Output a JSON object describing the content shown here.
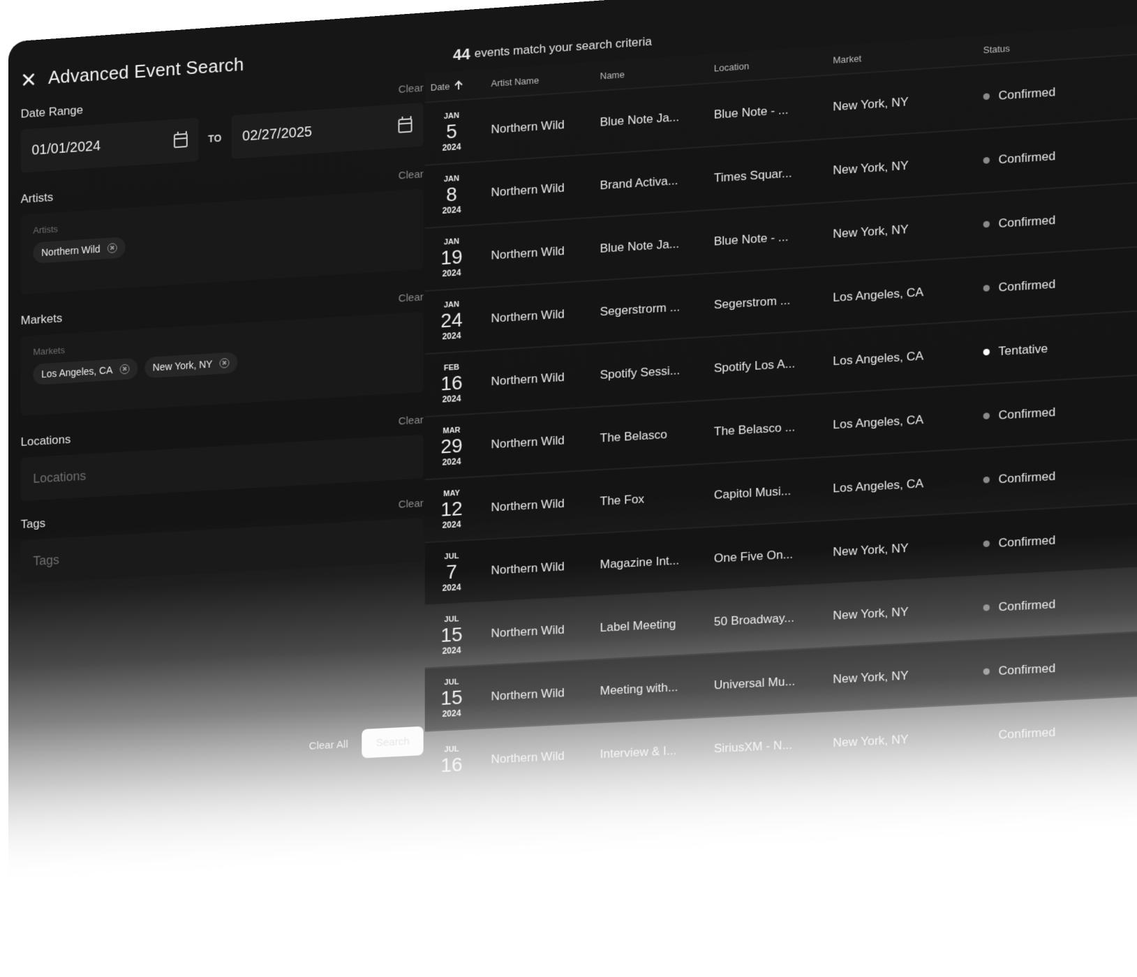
{
  "search": {
    "title": "Advanced Event Search",
    "date_range": {
      "label": "Date Range",
      "clear": "Clear",
      "from": "01/01/2024",
      "to_label": "TO",
      "to": "02/27/2025"
    },
    "artists": {
      "label": "Artists",
      "clear": "Clear",
      "field_label": "Artists",
      "chips": [
        "Northern Wild"
      ]
    },
    "markets": {
      "label": "Markets",
      "clear": "Clear",
      "field_label": "Markets",
      "chips": [
        "Los Angeles, CA",
        "New York, NY"
      ]
    },
    "locations": {
      "label": "Locations",
      "clear": "Clear",
      "placeholder": "Locations"
    },
    "tags": {
      "label": "Tags",
      "clear": "Clear",
      "placeholder": "Tags"
    },
    "footer": {
      "clear_all": "Clear All",
      "search": "Search"
    }
  },
  "results": {
    "count": "44",
    "count_text": "events match your search criteria",
    "columns": {
      "date": "Date",
      "artist": "Artist Name",
      "name": "Name",
      "location": "Location",
      "market": "Market",
      "status": "Status"
    },
    "rows": [
      {
        "month": "JAN",
        "day": "5",
        "year": "2024",
        "artist": "Northern Wild",
        "name": "Blue Note Ja...",
        "location": "Blue Note - ...",
        "market": "New York, NY",
        "status": "Confirmed"
      },
      {
        "month": "JAN",
        "day": "8",
        "year": "2024",
        "artist": "Northern Wild",
        "name": "Brand Activa...",
        "location": "Times Squar...",
        "market": "New York, NY",
        "status": "Confirmed"
      },
      {
        "month": "JAN",
        "day": "19",
        "year": "2024",
        "artist": "Northern Wild",
        "name": "Blue Note Ja...",
        "location": "Blue Note - ...",
        "market": "New York, NY",
        "status": "Confirmed"
      },
      {
        "month": "JAN",
        "day": "24",
        "year": "2024",
        "artist": "Northern Wild",
        "name": "Segerstrorm ...",
        "location": "Segerstrom ...",
        "market": "Los Angeles, CA",
        "status": "Confirmed"
      },
      {
        "month": "FEB",
        "day": "16",
        "year": "2024",
        "artist": "Northern Wild",
        "name": "Spotify Sessi...",
        "location": "Spotify Los A...",
        "market": "Los Angeles, CA",
        "status": "Tentative"
      },
      {
        "month": "MAR",
        "day": "29",
        "year": "2024",
        "artist": "Northern Wild",
        "name": "The Belasco",
        "location": "The Belasco ...",
        "market": "Los Angeles, CA",
        "status": "Confirmed"
      },
      {
        "month": "MAY",
        "day": "12",
        "year": "2024",
        "artist": "Northern Wild",
        "name": "The Fox",
        "location": "Capitol Musi...",
        "market": "Los Angeles, CA",
        "status": "Confirmed"
      },
      {
        "month": "JUL",
        "day": "7",
        "year": "2024",
        "artist": "Northern Wild",
        "name": "Magazine Int...",
        "location": "One Five On...",
        "market": "New York, NY",
        "status": "Confirmed"
      },
      {
        "month": "JUL",
        "day": "15",
        "year": "2024",
        "artist": "Northern Wild",
        "name": "Label Meeting",
        "location": "50 Broadway...",
        "market": "New York, NY",
        "status": "Confirmed"
      },
      {
        "month": "JUL",
        "day": "15",
        "year": "2024",
        "artist": "Northern Wild",
        "name": "Meeting with...",
        "location": "Universal Mu...",
        "market": "New York, NY",
        "status": "Confirmed"
      },
      {
        "month": "JUL",
        "day": "16",
        "year": "",
        "artist": "Northern Wild",
        "name": "Interview & I...",
        "location": "SiriusXM - N...",
        "market": "New York, NY",
        "status": "Confirmed"
      }
    ]
  }
}
